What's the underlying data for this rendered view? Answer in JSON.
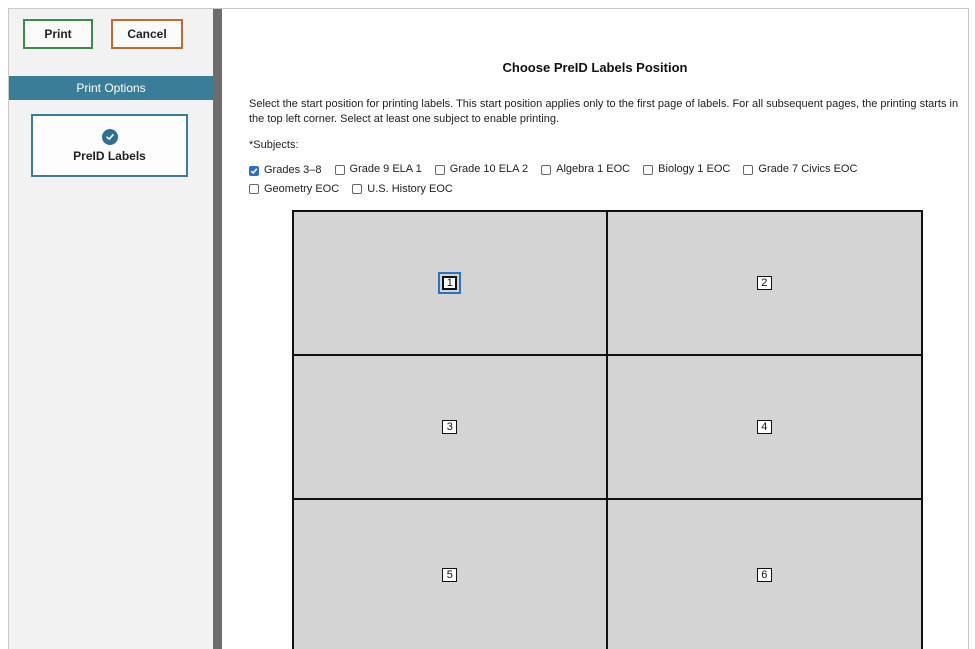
{
  "toolbar": {
    "print_label": "Print",
    "cancel_label": "Cancel"
  },
  "sidebar": {
    "header": "Print Options",
    "option": {
      "label": "PreID Labels",
      "icon": "check-circle-icon",
      "selected": true
    }
  },
  "main": {
    "title": "Choose PreID Labels Position",
    "intro": "Select the start position for printing labels. This start position applies only to the first page of labels. For all subsequent pages, the printing starts in the top left corner. Select at least one subject to enable printing.",
    "subjects_label": "*Subjects:",
    "subjects": [
      {
        "label": "Grades 3–8",
        "checked": true
      },
      {
        "label": "Grade 9 ELA 1",
        "checked": false
      },
      {
        "label": "Grade 10 ELA 2",
        "checked": false
      },
      {
        "label": "Algebra 1 EOC",
        "checked": false
      },
      {
        "label": "Biology 1 EOC",
        "checked": false
      },
      {
        "label": "Grade 7 Civics EOC",
        "checked": false
      },
      {
        "label": "Geometry EOC",
        "checked": false
      },
      {
        "label": "U.S. History EOC",
        "checked": false
      }
    ],
    "positions": [
      "1",
      "2",
      "3",
      "4",
      "5",
      "6"
    ],
    "selected_position": "1"
  },
  "colors": {
    "accent": "#3a7d98",
    "print_border": "#3d8a4b",
    "cancel_border": "#c26a2e",
    "checkbox_checked": "#2a72c5",
    "label_cell": "#d4d4d4"
  }
}
